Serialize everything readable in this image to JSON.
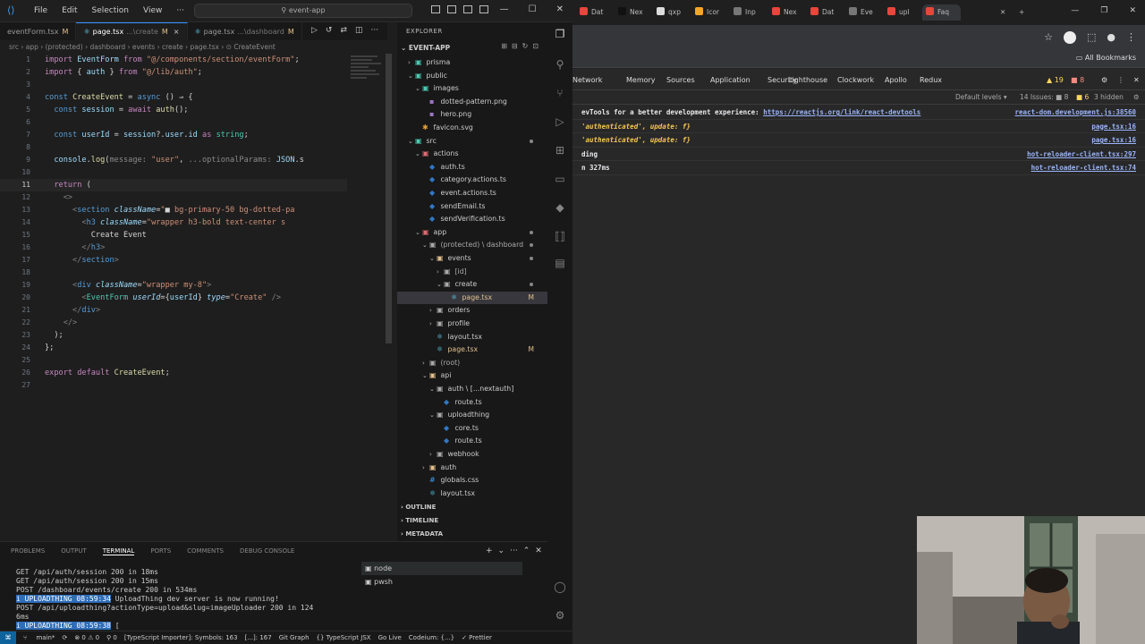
{
  "vscode": {
    "title_search": "event-app",
    "menu": [
      "File",
      "Edit",
      "Selection",
      "View",
      "···"
    ],
    "tabs": [
      {
        "name": "eventForm.tsx",
        "path": "",
        "modified": "M"
      },
      {
        "name": "page.tsx",
        "path": "...\\create",
        "modified": "M",
        "close": "×"
      },
      {
        "name": "page.tsx",
        "path": "...\\dashboard",
        "modified": "M"
      }
    ],
    "breadcrumb": "src › app › (protected) › dashboard › events › create › page.tsx › ⊙ CreateEvent",
    "code_lines": [
      {
        "n": "1",
        "html": "<span class='kw'>import</span> <span class='id'>EventForm</span> <span class='kw'>from</span> <span class='str'>\"@/components/section/eventForm\"</span>;"
      },
      {
        "n": "2",
        "html": "<span class='kw'>import</span> { <span class='id'>auth</span> } <span class='kw'>from</span> <span class='str'>\"@/lib/auth\"</span>;"
      },
      {
        "n": "3",
        "html": ""
      },
      {
        "n": "4",
        "html": "<span class='kwb'>const</span> <span class='fn'>CreateEvent</span> = <span class='kwb'>async</span> () ⇒ {"
      },
      {
        "n": "5",
        "html": "  <span class='kwb'>const</span> <span class='id'>session</span> = <span class='kw'>await</span> <span class='fn'>auth</span>();"
      },
      {
        "n": "6",
        "html": ""
      },
      {
        "n": "7",
        "html": "  <span class='kwb'>const</span> <span class='id'>userId</span> = <span class='id'>session</span>?.<span class='id'>user</span>.<span class='id'>id</span> <span class='kw'>as</span> <span class='comp'>string</span>;"
      },
      {
        "n": "8",
        "html": ""
      },
      {
        "n": "9",
        "html": "  <span class='id'>console</span>.<span class='fn'>log</span>(<span class='hint'>message:</span> <span class='str'>\"user\"</span>, <span class='hint'>...optionalParams:</span> <span class='id'>JSON</span>.s"
      },
      {
        "n": "10",
        "html": ""
      },
      {
        "n": "11",
        "html": "  <span class='kw'>return</span> (",
        "current": true
      },
      {
        "n": "12",
        "html": "    <span class='tag'>&lt;&gt;</span>"
      },
      {
        "n": "13",
        "html": "      <span class='tag'>&lt;</span><span class='tagn'>section</span> <span class='attr'>className</span>=<span class='str'>\"</span>■ <span class='str'>bg-primary-50 bg-dotted-pa</span>"
      },
      {
        "n": "14",
        "html": "        <span class='tag'>&lt;</span><span class='tagn'>h3</span> <span class='attr'>className</span>=<span class='str'>\"wrapper h3-bold text-center s</span>"
      },
      {
        "n": "15",
        "html": "          Create Event"
      },
      {
        "n": "16",
        "html": "        <span class='tag'>&lt;/</span><span class='tagn'>h3</span><span class='tag'>&gt;</span>"
      },
      {
        "n": "17",
        "html": "      <span class='tag'>&lt;/</span><span class='tagn'>section</span><span class='tag'>&gt;</span>"
      },
      {
        "n": "18",
        "html": ""
      },
      {
        "n": "19",
        "html": "      <span class='tag'>&lt;</span><span class='tagn'>div</span> <span class='attr'>className</span>=<span class='str'>\"wrapper my-8\"</span><span class='tag'>&gt;</span>"
      },
      {
        "n": "20",
        "html": "        <span class='tag'>&lt;</span><span class='comp'>EventForm</span> <span class='attr'>userId</span>={<span class='id'>userId</span>} <span class='attr'>type</span>=<span class='str'>\"Create\"</span> <span class='tag'>/&gt;</span>"
      },
      {
        "n": "21",
        "html": "      <span class='tag'>&lt;/</span><span class='tagn'>div</span><span class='tag'>&gt;</span>"
      },
      {
        "n": "22",
        "html": "    <span class='tag'>&lt;/&gt;</span>"
      },
      {
        "n": "23",
        "html": "  );"
      },
      {
        "n": "24",
        "html": "};"
      },
      {
        "n": "25",
        "html": ""
      },
      {
        "n": "26",
        "html": "<span class='kw'>export</span> <span class='kw'>default</span> <span class='fn'>CreateEvent</span>;"
      },
      {
        "n": "27",
        "html": ""
      }
    ],
    "explorer": {
      "header": "EXPLORER",
      "project": "EVENT-APP",
      "rows": [
        {
          "depth": 1,
          "chev": "›",
          "icon": "▣",
          "color": "#4ec9b0",
          "label": "prisma"
        },
        {
          "depth": 1,
          "chev": "⌄",
          "icon": "▣",
          "color": "#4ec9b0",
          "label": "public"
        },
        {
          "depth": 2,
          "chev": "⌄",
          "icon": "▣",
          "color": "#4ec9b0",
          "label": "images"
        },
        {
          "depth": 3,
          "chev": "",
          "icon": "▪",
          "color": "#a074c4",
          "label": "dotted-pattern.png"
        },
        {
          "depth": 3,
          "chev": "",
          "icon": "▪",
          "color": "#a074c4",
          "label": "hero.png"
        },
        {
          "depth": 2,
          "chev": "",
          "icon": "✱",
          "color": "#e2a33a",
          "label": "favicon.svg"
        },
        {
          "depth": 1,
          "chev": "⌄",
          "icon": "▣",
          "color": "#4ec9b0",
          "label": "src",
          "dot": true
        },
        {
          "depth": 2,
          "chev": "⌄",
          "icon": "▣",
          "color": "#e06c75",
          "label": "actions"
        },
        {
          "depth": 3,
          "chev": "",
          "icon": "◆",
          "color": "#3178c6",
          "label": "auth.ts"
        },
        {
          "depth": 3,
          "chev": "",
          "icon": "◆",
          "color": "#3178c6",
          "label": "category.actions.ts"
        },
        {
          "depth": 3,
          "chev": "",
          "icon": "◆",
          "color": "#3178c6",
          "label": "event.actions.ts"
        },
        {
          "depth": 3,
          "chev": "",
          "icon": "◆",
          "color": "#3178c6",
          "label": "sendEmail.ts"
        },
        {
          "depth": 3,
          "chev": "",
          "icon": "◆",
          "color": "#3178c6",
          "label": "sendVerification.ts"
        },
        {
          "depth": 2,
          "chev": "⌄",
          "icon": "▣",
          "color": "#e06c75",
          "label": "app",
          "dot": true
        },
        {
          "depth": 3,
          "chev": "⌄",
          "icon": "▣",
          "color": "#aaa",
          "label": "(protected) \\ dashboard",
          "dot": true
        },
        {
          "depth": 4,
          "chev": "⌄",
          "icon": "▣",
          "color": "#e2c08d",
          "label": "events",
          "dot": true
        },
        {
          "depth": 5,
          "chev": "›",
          "icon": "▣",
          "color": "#aaa",
          "label": "[id]"
        },
        {
          "depth": 5,
          "chev": "⌄",
          "icon": "▣",
          "color": "#aaa",
          "label": "create",
          "dot": true
        },
        {
          "depth": 6,
          "chev": "",
          "icon": "⚛",
          "color": "#61dafb",
          "label": "page.tsx",
          "badge": "M",
          "sel": true
        },
        {
          "depth": 4,
          "chev": "›",
          "icon": "▣",
          "color": "#aaa",
          "label": "orders"
        },
        {
          "depth": 4,
          "chev": "›",
          "icon": "▣",
          "color": "#aaa",
          "label": "profile"
        },
        {
          "depth": 4,
          "chev": "",
          "icon": "⚛",
          "color": "#61dafb",
          "label": "layout.tsx"
        },
        {
          "depth": 4,
          "chev": "",
          "icon": "⚛",
          "color": "#61dafb",
          "label": "page.tsx",
          "badge": "M"
        },
        {
          "depth": 3,
          "chev": "›",
          "icon": "▣",
          "color": "#aaa",
          "label": "(root)"
        },
        {
          "depth": 3,
          "chev": "⌄",
          "icon": "▣",
          "color": "#e2c08d",
          "label": "api"
        },
        {
          "depth": 4,
          "chev": "⌄",
          "icon": "▣",
          "color": "#aaa",
          "label": "auth \\ [...nextauth]"
        },
        {
          "depth": 5,
          "chev": "",
          "icon": "◆",
          "color": "#3178c6",
          "label": "route.ts"
        },
        {
          "depth": 4,
          "chev": "⌄",
          "icon": "▣",
          "color": "#aaa",
          "label": "uploadthing"
        },
        {
          "depth": 5,
          "chev": "",
          "icon": "◆",
          "color": "#3178c6",
          "label": "core.ts"
        },
        {
          "depth": 5,
          "chev": "",
          "icon": "◆",
          "color": "#3178c6",
          "label": "route.ts"
        },
        {
          "depth": 4,
          "chev": "›",
          "icon": "▣",
          "color": "#aaa",
          "label": "webhook"
        },
        {
          "depth": 3,
          "chev": "›",
          "icon": "▣",
          "color": "#e2c08d",
          "label": "auth"
        },
        {
          "depth": 3,
          "chev": "",
          "icon": "#",
          "color": "#3ea0f3",
          "label": "globals.css"
        },
        {
          "depth": 3,
          "chev": "",
          "icon": "⚛",
          "color": "#61dafb",
          "label": "layout.tsx"
        }
      ],
      "sections": [
        "OUTLINE",
        "TIMELINE",
        "METADATA"
      ]
    },
    "panel": {
      "tabs": [
        "PROBLEMS",
        "OUTPUT",
        "TERMINAL",
        "PORTS",
        "COMMENTS",
        "DEBUG CONSOLE"
      ],
      "active_tab": "TERMINAL",
      "terminal_lines": [
        {
          "text": "GET /api/auth/session 200 in 18ms"
        },
        {
          "text": "GET /api/auth/session 200 in 15ms"
        },
        {
          "text": "POST /dashboard/events/create 200 in 534ms"
        },
        {
          "badge": "i UPLOADTHING 08:59:34",
          "text": " UploadThing dev server is now running!"
        },
        {
          "text": "POST /api/uploadthing?actionType=upload&slug=imageUploader 200 in 124"
        },
        {
          "text": "6ms"
        },
        {
          "badge": "i UPLOADTHING 08:59:38",
          "text": " ["
        }
      ],
      "terminals": [
        "node",
        "pwsh"
      ]
    },
    "status": {
      "branch": "main*",
      "sync": "⟳",
      "problems": "⊗ 0 ⚠ 0",
      "ports": "⚲ 0",
      "importer": "[TypeScript Importer]: Symbols: 163",
      "cursor": "[...]: 167",
      "git": "Git Graph",
      "lang": "{} TypeScript JSX",
      "live": "Go Live",
      "codeium": "Codeium: {...}",
      "prettier": "✓ Prettier"
    }
  },
  "chrome": {
    "tabs": [
      "Dat",
      "Nex",
      "qxp",
      "Icor",
      "Inp",
      "Nex",
      "Dat",
      "Eve",
      "upl",
      "Faq"
    ],
    "all_bookmarks": "All Bookmarks",
    "devtools_tabs": [
      "Network",
      "Memory",
      "Sources",
      "Application",
      "Security",
      "Lighthouse",
      "Clockwork",
      "Apollo",
      "Redux"
    ],
    "issues": "▲ 19",
    "errors": "■ 8",
    "issues_count": "14 Issues: ■ 8",
    "warn_count": "■ 6",
    "hidden": "3 hidden",
    "default_levels": "Default levels ▾",
    "console": [
      {
        "msg": "evTools for a better development experience: ",
        "link": "https://reactjs.org/link/react-devtools",
        "src": "react-dom.development.js:38560"
      },
      {
        "msg": "'authenticated', update: f}",
        "italic": true,
        "src": "page.tsx:16"
      },
      {
        "msg": "'authenticated', update: f}",
        "italic": true,
        "src": "page.tsx:16"
      },
      {
        "msg": "ding",
        "src": "hot-reloader-client.tsx:297"
      },
      {
        "msg": "n 327ms",
        "src": "hot-reloader-client.tsx:74"
      }
    ]
  }
}
